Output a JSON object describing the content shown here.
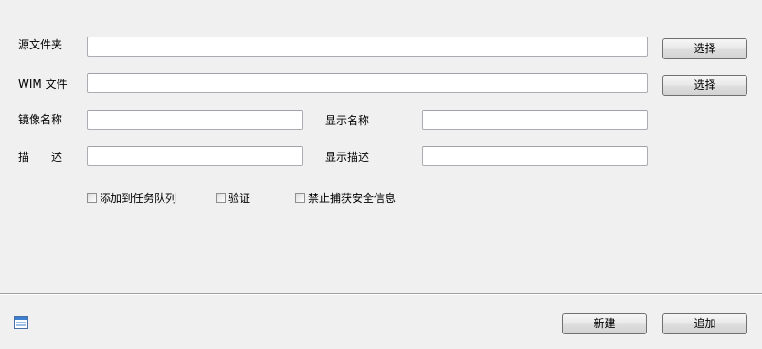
{
  "form": {
    "source_folder": {
      "label": "源文件夹",
      "value": "",
      "browse_label": "选择"
    },
    "wim_file": {
      "label": "WIM 文件",
      "value": "",
      "browse_label": "选择"
    },
    "image_name": {
      "label": "镜像名称",
      "value": ""
    },
    "display_name": {
      "label": "显示名称",
      "value": ""
    },
    "description": {
      "label_chars": [
        "描",
        "述"
      ],
      "value": ""
    },
    "display_description": {
      "label": "显示描述",
      "value": ""
    }
  },
  "options": [
    {
      "label": "添加到任务队列",
      "checked": false
    },
    {
      "label": "验证",
      "checked": false
    },
    {
      "label": "禁止捕获安全信息",
      "checked": false
    }
  ],
  "footer": {
    "icon": "window-icon",
    "new_label": "新建",
    "append_label": "追加"
  }
}
